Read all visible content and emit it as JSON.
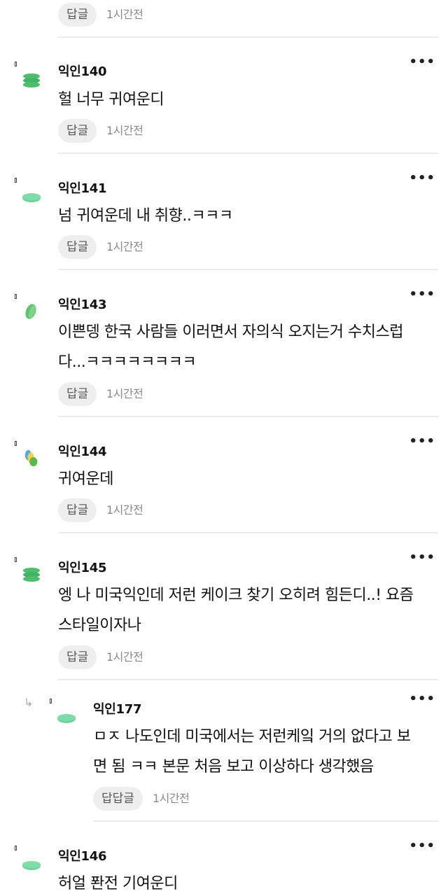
{
  "reply_label": "답글",
  "time_label": "1시간전",
  "top_reply": {
    "label": "답글",
    "time": "1시간전"
  },
  "comments": [
    {
      "author": "익인140",
      "lines": [
        "헐 너무 귀여운디"
      ],
      "avatar_color": "#4cbe6e",
      "avatar": "stack"
    },
    {
      "author": "익인141",
      "lines": [
        "넘 귀여운데 내 취향..ㅋㅋㅋ"
      ],
      "avatar_color": "#6dd49a",
      "avatar": "disc"
    },
    {
      "author": "익인143",
      "lines": [
        "이쁜뎅 한국 사람들 이러면서 자의식 오지는거 수치스럽",
        "다...ㅋㅋㅋㅋㅋㅋㅋㅋ"
      ],
      "avatar_color": "#5fc26e",
      "avatar": "leaf"
    },
    {
      "author": "익인144",
      "lines": [
        "귀여운데"
      ],
      "avatar_color": "#6cc24a",
      "avatar": "multi"
    },
    {
      "author": "익인145",
      "lines": [
        "엥 나 미국익인데 저런 케이크 찾기 오히려 힘든디..! 요즘",
        "스타일이자나"
      ],
      "avatar_color": "#4cbe6e",
      "avatar": "stack"
    },
    {
      "author": "익인177",
      "lines": [
        "ㅁㅈ 나도인데 미국에서는 저런케잌 거의 없다고 보",
        "면 됨 ㅋㅋ 본문 처음 보고 이상하다 생각했음"
      ],
      "avatar_color": "#6dd49a",
      "avatar": "disc",
      "reply_label": "답답글"
    },
    {
      "author": "익인146",
      "lines": [
        "허얼 퐌전 기여운디"
      ],
      "avatar_color": "#6dd49a",
      "avatar": "disc"
    }
  ],
  "icons": {
    "more": "more-dots-icon",
    "reply": "reply-arrow-icon",
    "marker": "level-marker-icon"
  }
}
